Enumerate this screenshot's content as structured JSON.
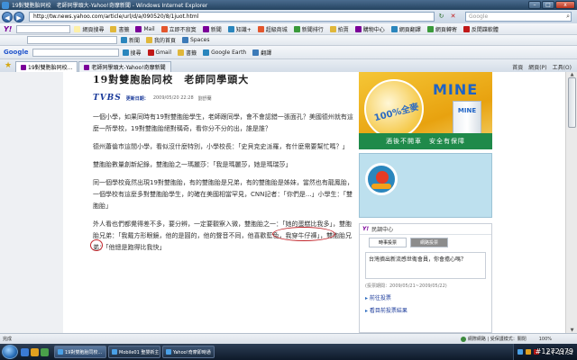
{
  "window": {
    "title": "19對雙胞胎同校　老師同學頭大-Yahoo!奇摩新聞 - Windows Internet Explorer",
    "controls": [
      "–",
      "□",
      "x"
    ]
  },
  "addressbar": {
    "url": "http://tw.news.yahoo.com/article/url/d/a/090520/8/1juot.html",
    "search_placeholder": "Google"
  },
  "toolbar_yahoo": {
    "logo": "Y!",
    "items": [
      {
        "label": "網頁搜尋",
        "color": "#fdf0a8"
      },
      {
        "label": "書籤",
        "color": "#e0b73a"
      },
      {
        "label": "Mail",
        "color": "#7b0099"
      },
      {
        "label": "立即不寂寞",
        "color": "#e4562d"
      },
      {
        "label": "新聞",
        "color": "#7b0099"
      },
      {
        "label": "知識+",
        "color": "#2a86bd"
      },
      {
        "label": "超級商城",
        "color": "#e4562d"
      },
      {
        "label": "新聞排行",
        "color": "#3a9a3a"
      },
      {
        "label": "拍賣",
        "color": "#e0b73a"
      },
      {
        "label": "購物中心",
        "color": "#7b0099"
      },
      {
        "label": "網頁翻譯",
        "color": "#2a86bd"
      },
      {
        "label": "網頁轉寄",
        "color": "#3a9a3a"
      },
      {
        "label": "反間諜軟體",
        "color": "#c01818"
      }
    ]
  },
  "toolbar_links": {
    "items": [
      {
        "label": "新聞",
        "color": "#2a86bd"
      },
      {
        "label": "我的首頁",
        "color": "#e0b73a"
      },
      {
        "label": "Spaces",
        "color": "#3c7ab8"
      }
    ]
  },
  "toolbar_google": {
    "logo": "Google",
    "items": [
      {
        "label": "搜尋",
        "color": "#2a86bd"
      },
      {
        "label": "Gmail",
        "color": "#c01818"
      },
      {
        "label": "書籤",
        "color": "#e0b73a"
      },
      {
        "label": "Google Earth",
        "color": "#2a86bd"
      },
      {
        "label": "翻譯",
        "color": "#3c7ab8"
      }
    ]
  },
  "tabs": [
    {
      "label": "19對雙胞胎同校..."
    },
    {
      "label": "老師同學頭大-Yahoo!奇摩新聞"
    }
  ],
  "tab_tools": [
    "首頁",
    "網頁(P)",
    "工具(O)"
  ],
  "article": {
    "headline": "19對雙胞胎同校　老師同學頭大",
    "source_logo": "TVBS",
    "updated_label": "更新日期：",
    "updated_time": "2009/05/20 22:28",
    "author": "劉舒蘭",
    "paragraphs": [
      "一個小學，如果同時有19對雙胞胎學生，老師跟同學，會不會認錯一張面孔？美國德州就有這麼一所學校，19對雙胞胎絕對稱奇，看你分不分的出，誰是誰？",
      "德州蕭倫市這間小學，看似沒什麼特別，小學校長：「史貝克史派羅，有什麼需要幫忙嗎？」",
      "雙胞胎數量創新紀錄，雙胞胎之一瑪麗莎：「我是瑪麗莎，她是瑪瑞莎」",
      "同一個學校竟然出現19對雙胞胎，有的雙胞胎是兄弟，有的雙胞胎是姊妹，當然也有龍鳳胎，一個學校有這麼多對雙胞胎學生，的確在美國相當罕見，CNN記者：「你們是...」小學生：「雙胞胎」",
      "外人看也們都覺得差不多，要分辨，一定要觀察入微，雙胞胎之一：「她的蛋糕比我多」，雙胞胎兄弟：「我戴方形眼鏡，他的是圓的，他的聲音不同，他喜歡藍色，我穿牛仔褲」，雙胞胎兄弟：「他總是跑得比我快」"
    ]
  },
  "ad": {
    "brand": "MINE",
    "badge": "100%全麥",
    "can_label": "MINE",
    "slogan": "酒後不開車　安全有保障"
  },
  "poll": {
    "logo": "Y!",
    "title": "民調中心",
    "tabs": [
      "時事投票",
      "網路投票"
    ],
    "question": "台灣擠出新流感世衛會員，你會擔心嗎？",
    "period": "(投票期間：2009/05/21~2009/05/22)",
    "links": [
      "前往投票",
      "看目前投票結果"
    ]
  },
  "statusbar": {
    "left": "完成",
    "zone": "網際網路 | 受保護模式：關閉",
    "zoom": "100%"
  },
  "taskbar": {
    "buttons": [
      {
        "label": "19對雙胞胎同校...",
        "active": true
      },
      {
        "label": "Mobile01 聖嬰新主...",
        "active": false
      },
      {
        "label": "Yahoo!奇摩即時通",
        "active": false
      }
    ],
    "quick_launch_colors": [
      "#3a7bd5",
      "#e0a020",
      "#4aa04a"
    ],
    "tray_colors": [
      "#4aa0e6",
      "#e0a020",
      "#c01818"
    ],
    "clock": "上午 11:52"
  },
  "watermark": "#1272979"
}
